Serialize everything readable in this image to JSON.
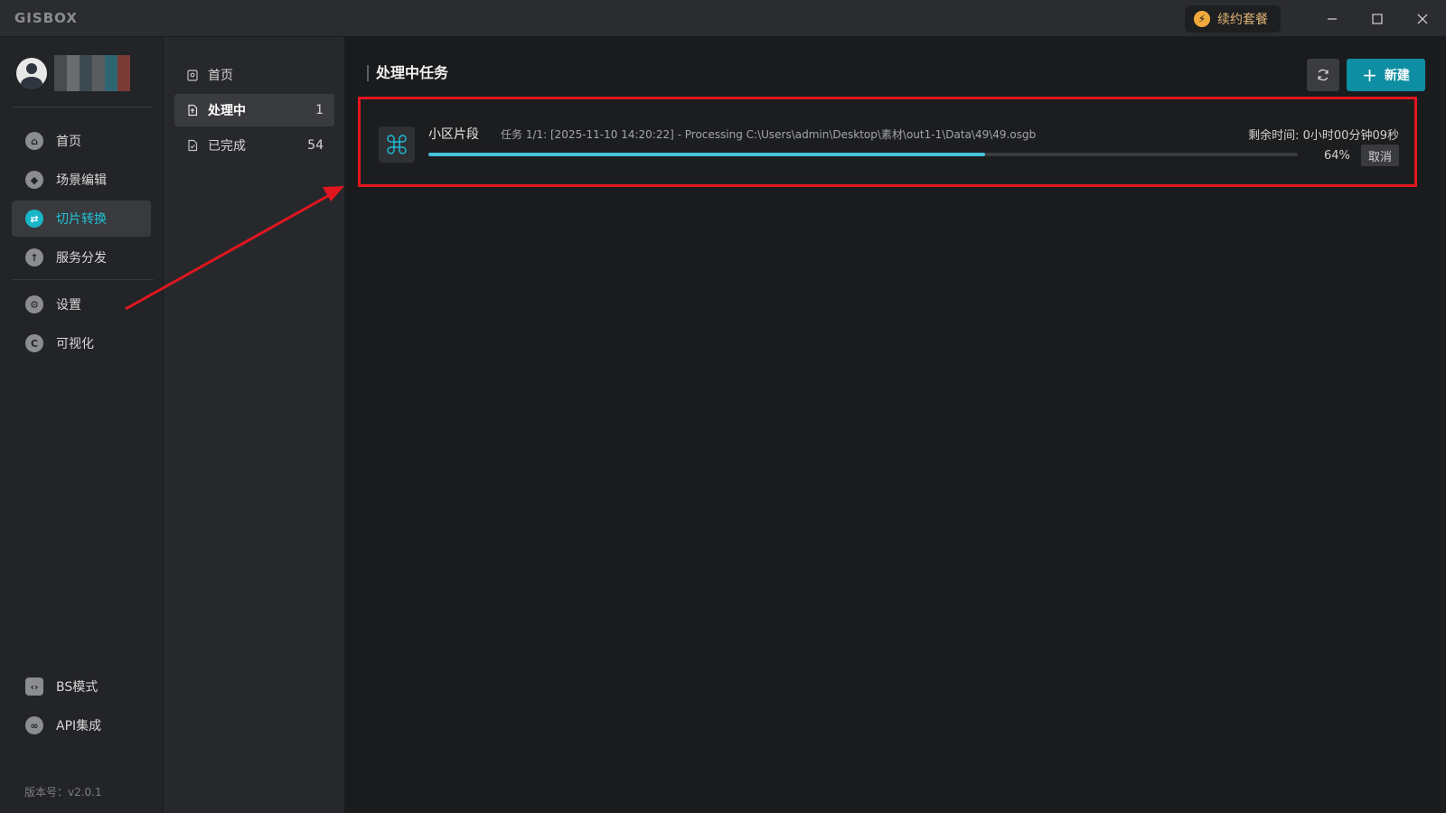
{
  "app": {
    "logo": "GISBOX"
  },
  "titlebar": {
    "plan_label": "续约套餐"
  },
  "leftnav": {
    "items": [
      {
        "label": "首页",
        "icon": "home-icon"
      },
      {
        "label": "场景编辑",
        "icon": "cube-icon"
      },
      {
        "label": "切片转换",
        "icon": "swap-icon",
        "active": true
      },
      {
        "label": "服务分发",
        "icon": "upload-icon"
      },
      {
        "label": "设置",
        "icon": "gear-icon"
      },
      {
        "label": "可视化",
        "icon": "chart-icon"
      },
      {
        "label": "BS模式",
        "icon": "code-icon"
      },
      {
        "label": "API集成",
        "icon": "link-icon"
      }
    ],
    "version": "版本号：v2.0.1"
  },
  "midnav": {
    "items": [
      {
        "label": "首页",
        "count": ""
      },
      {
        "label": "处理中",
        "count": "1",
        "active": true
      },
      {
        "label": "已完成",
        "count": "54"
      }
    ]
  },
  "content": {
    "title": "处理中任务",
    "new_label": "新建",
    "task": {
      "name": "小区片段",
      "description": "任务 1/1:  [2025-11-10 14:20:22]  -  Processing C:\\Users\\admin\\Desktop\\素材\\out1-1\\Data\\49\\49.osgb",
      "remaining": "剩余时间:  0小时00分钟09秒",
      "percent_label": "64%",
      "progress": 0.64,
      "cancel_label": "取消"
    }
  },
  "colors": {
    "accent": "#19b5c9",
    "primary_button": "#0e8ea3",
    "highlight_border": "#e1161f"
  }
}
